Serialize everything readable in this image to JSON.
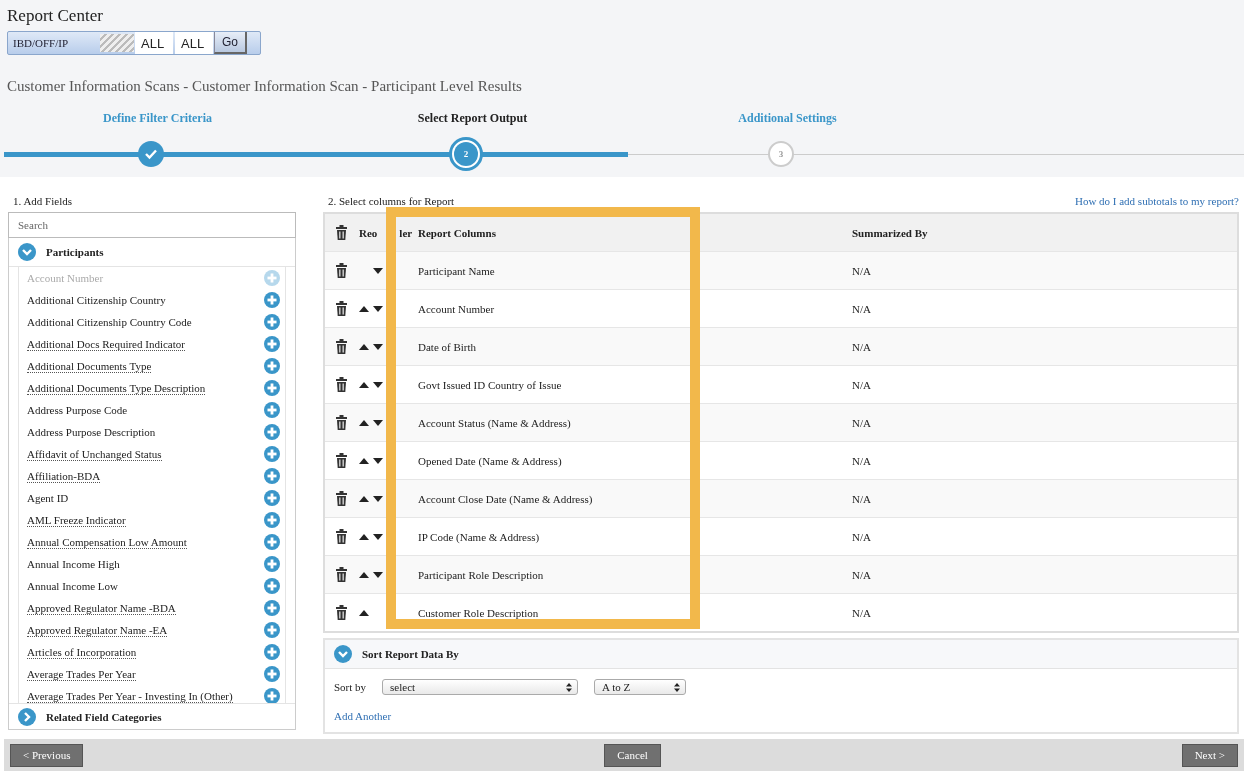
{
  "app_title": "Report Center",
  "toolbar": {
    "segment": "IBD/OFF/IP",
    "filters": [
      "ALL",
      "ALL"
    ],
    "go_button": "Go"
  },
  "report_title": "Customer Information Scans - Customer Information Scan - Participant Level Results",
  "steps": [
    {
      "label": "Define Filter Criteria",
      "completed": true,
      "selected": false
    },
    {
      "label": "Select Report Output",
      "number": "2",
      "completed": false,
      "selected": true
    },
    {
      "label": "Additional Settings",
      "number": "3",
      "completed": false,
      "selected": false
    }
  ],
  "fields_panel": {
    "heading": "1. Add Fields",
    "search_placeholder": "Search",
    "category": {
      "label": "Participants",
      "expanded": true
    },
    "items": [
      {
        "label": "Account Number",
        "disabled": true,
        "underlined": false
      },
      {
        "label": "Additional Citizenship Country",
        "disabled": false,
        "underlined": false
      },
      {
        "label": "Additional Citizenship Country Code",
        "disabled": false,
        "underlined": false
      },
      {
        "label": "Additional Docs Required Indicator",
        "disabled": false,
        "underlined": true
      },
      {
        "label": "Additional Documents Type",
        "disabled": false,
        "underlined": true
      },
      {
        "label": "Additional Documents Type Description",
        "disabled": false,
        "underlined": true
      },
      {
        "label": "Address Purpose Code",
        "disabled": false,
        "underlined": false
      },
      {
        "label": "Address Purpose Description",
        "disabled": false,
        "underlined": false
      },
      {
        "label": "Affidavit of Unchanged Status",
        "disabled": false,
        "underlined": true
      },
      {
        "label": "Affiliation-BDA",
        "disabled": false,
        "underlined": true
      },
      {
        "label": "Agent ID",
        "disabled": false,
        "underlined": false
      },
      {
        "label": "AML Freeze Indicator",
        "disabled": false,
        "underlined": true
      },
      {
        "label": "Annual Compensation Low Amount",
        "disabled": false,
        "underlined": true
      },
      {
        "label": "Annual Income High",
        "disabled": false,
        "underlined": false
      },
      {
        "label": "Annual Income Low",
        "disabled": false,
        "underlined": false
      },
      {
        "label": "Approved Regulator Name -BDA",
        "disabled": false,
        "underlined": true
      },
      {
        "label": "Approved Regulator Name -EA",
        "disabled": false,
        "underlined": true
      },
      {
        "label": "Articles of Incorporation",
        "disabled": false,
        "underlined": true
      },
      {
        "label": "Average Trades Per Year",
        "disabled": false,
        "underlined": true
      },
      {
        "label": "Average Trades Per Year - Investing In (Other)",
        "disabled": false,
        "underlined": true
      }
    ],
    "related": {
      "label": "Related Field Categories",
      "expanded": false
    }
  },
  "columns_panel": {
    "heading": "2. Select columns for Report",
    "help_link": "How do I add subtotals to my report?",
    "reorder_header_parts": [
      "Reo",
      "ler"
    ],
    "columns_header": "Report Columns",
    "summary_header": "Summarized By",
    "rows": [
      {
        "name": "Participant Name",
        "summarized_by": "N/A",
        "can_move_up": false,
        "can_move_down": true
      },
      {
        "name": "Account Number",
        "summarized_by": "N/A",
        "can_move_up": true,
        "can_move_down": true
      },
      {
        "name": "Date of Birth",
        "summarized_by": "N/A",
        "can_move_up": true,
        "can_move_down": true
      },
      {
        "name": "Govt Issued ID Country of Issue",
        "summarized_by": "N/A",
        "can_move_up": true,
        "can_move_down": true
      },
      {
        "name": "Account Status (Name & Address)",
        "summarized_by": "N/A",
        "can_move_up": true,
        "can_move_down": true
      },
      {
        "name": "Opened Date (Name & Address)",
        "summarized_by": "N/A",
        "can_move_up": true,
        "can_move_down": true
      },
      {
        "name": "Account Close Date (Name & Address)",
        "summarized_by": "N/A",
        "can_move_up": true,
        "can_move_down": true
      },
      {
        "name": "IP Code (Name & Address)",
        "summarized_by": "N/A",
        "can_move_up": true,
        "can_move_down": true
      },
      {
        "name": "Participant Role Description",
        "summarized_by": "N/A",
        "can_move_up": true,
        "can_move_down": true
      },
      {
        "name": "Customer Role Description",
        "summarized_by": "N/A",
        "can_move_up": true,
        "can_move_down": false
      }
    ]
  },
  "sort": {
    "title": "Sort Report Data By",
    "expanded": true,
    "label": "Sort by",
    "field_value": "select",
    "order_value": "A to Z",
    "add_link": "Add Another"
  },
  "footer": {
    "previous": "< Previous",
    "cancel": "Cancel",
    "next": "Next >"
  }
}
